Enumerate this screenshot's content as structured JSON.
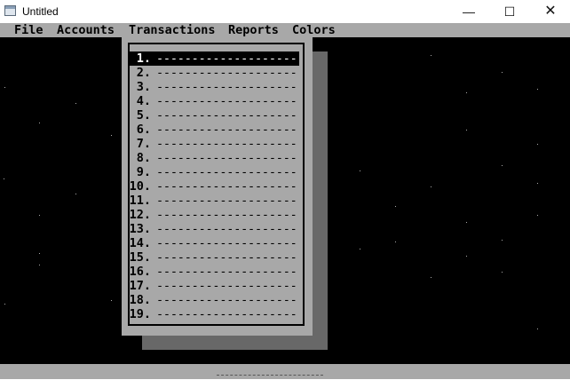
{
  "window": {
    "title": "Untitled",
    "minimize_glyph": "—",
    "maximize_glyph": "☐",
    "close_glyph": "✕"
  },
  "menubar": {
    "items": [
      "File",
      "Accounts",
      "Transactions",
      "Reports",
      "Colors"
    ]
  },
  "transactions_menu": {
    "selected_index": 0,
    "items": [
      {
        "number": "1.",
        "label": "--------------------"
      },
      {
        "number": "2.",
        "label": "--------------------"
      },
      {
        "number": "3.",
        "label": "--------------------"
      },
      {
        "number": "4.",
        "label": "--------------------"
      },
      {
        "number": "5.",
        "label": "--------------------"
      },
      {
        "number": "6.",
        "label": "--------------------"
      },
      {
        "number": "7.",
        "label": "--------------------"
      },
      {
        "number": "8.",
        "label": "--------------------"
      },
      {
        "number": "9.",
        "label": "--------------------"
      },
      {
        "number": "10.",
        "label": "--------------------"
      },
      {
        "number": "11.",
        "label": "--------------------"
      },
      {
        "number": "12.",
        "label": "--------------------"
      },
      {
        "number": "13.",
        "label": "--------------------"
      },
      {
        "number": "14.",
        "label": "--------------------"
      },
      {
        "number": "15.",
        "label": "--------------------"
      },
      {
        "number": "16.",
        "label": "--------------------"
      },
      {
        "number": "17.",
        "label": "--------------------"
      },
      {
        "number": "18.",
        "label": "--------------------"
      },
      {
        "number": "19.",
        "label": "--------------------"
      }
    ]
  },
  "colors": {
    "menu_bg": "#a8a8a8",
    "screen_bg": "#000000",
    "selected_bg": "#000000",
    "selected_fg": "#ffffff"
  }
}
